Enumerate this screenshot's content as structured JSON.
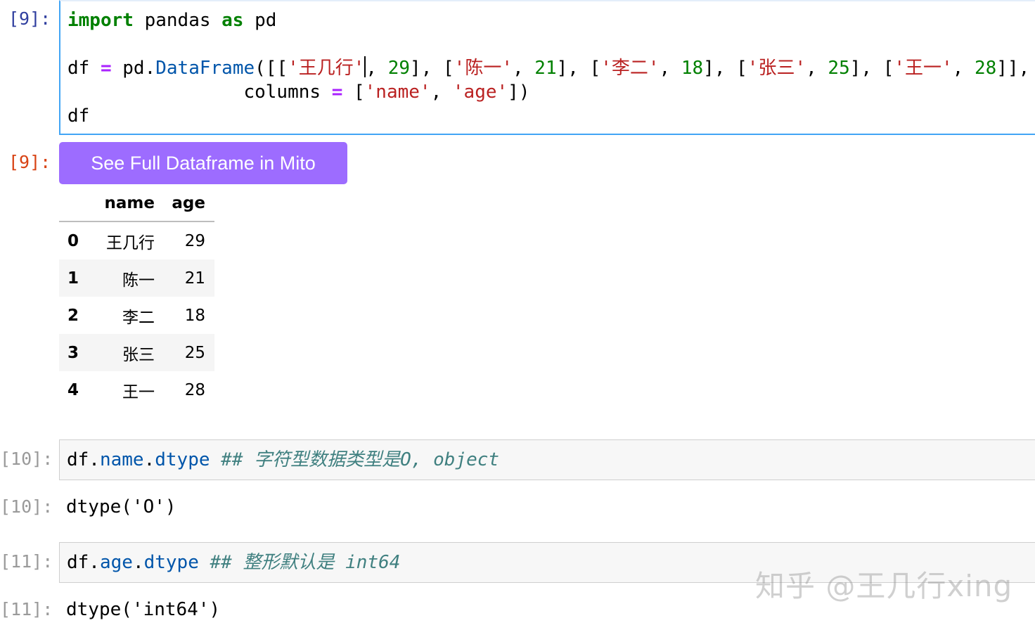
{
  "cells": [
    {
      "in_prompt": "[9]:",
      "out_prompt": "[9]:",
      "code_lines": {
        "l1_kw1": "import",
        "l1_mid": " pandas ",
        "l1_kw2": "as",
        "l1_end": " pd",
        "l3_a": "df ",
        "l3_eq": "=",
        "l3_b": " pd.",
        "l3_cls": "DataFrame",
        "l3_c": "([[",
        "l3_s1": "'王几行'",
        "l3_d": ", ",
        "l3_n1": "29",
        "l3_e": "], [",
        "l3_s2": "'陈一'",
        "l3_f": ", ",
        "l3_n2": "21",
        "l3_g": "], [",
        "l3_s3": "'李二'",
        "l3_h": ", ",
        "l3_n3": "18",
        "l3_i": "], [",
        "l3_s4": "'张三'",
        "l3_j": ", ",
        "l3_n4": "25",
        "l3_k": "], [",
        "l3_s5": "'王一'",
        "l3_l": ", ",
        "l3_n5": "28",
        "l3_m": "]],",
        "l4_a": "                columns ",
        "l4_eq": "=",
        "l4_b": " [",
        "l4_s1": "'name'",
        "l4_c": ", ",
        "l4_s2": "'age'",
        "l4_d": "])",
        "l5": "df"
      },
      "mito_button": "See Full Dataframe in Mito",
      "table": {
        "columns": [
          "name",
          "age"
        ],
        "rows": [
          {
            "index": "0",
            "name": "王几行",
            "age": "29"
          },
          {
            "index": "1",
            "name": "陈一",
            "age": "21"
          },
          {
            "index": "2",
            "name": "李二",
            "age": "18"
          },
          {
            "index": "3",
            "name": "张三",
            "age": "25"
          },
          {
            "index": "4",
            "name": "王一",
            "age": "28"
          }
        ]
      }
    },
    {
      "in_prompt": "[10]:",
      "out_prompt": "[10]:",
      "code_a": "df.",
      "code_attr1": "name",
      "code_dot": ".",
      "code_attr2": "dtype",
      "comment": " ## 字符型数据类型是O, object",
      "output": "dtype('O')"
    },
    {
      "in_prompt": "[11]:",
      "out_prompt": "[11]:",
      "code_a": "df.",
      "code_attr1": "age",
      "code_dot": ".",
      "code_attr2": "dtype",
      "comment": " ## 整形默认是 int64",
      "output": "dtype('int64')"
    }
  ],
  "watermark": "知乎 @王几行xing",
  "colors": {
    "mito_button": "#9d6cff",
    "active_cell_border": "#42a5f5",
    "keyword": "#008000",
    "string": "#ba2121",
    "operator": "#aa22ff",
    "attribute": "#0055aa",
    "comment": "#408080"
  }
}
